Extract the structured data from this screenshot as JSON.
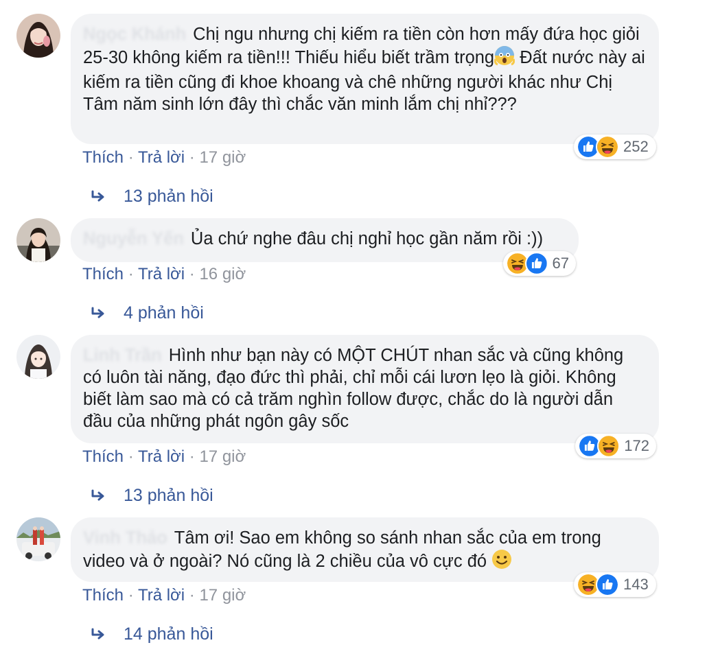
{
  "comments": [
    {
      "author": "Ngọc Khánh",
      "text_before_emoji": "Chị ngu nhưng chị kiếm ra tiền còn hơn mấy đứa học giỏi 25-30 không kiếm ra tiền!!! Thiếu hiểu biết trầm trọng",
      "emoji": "scream-emoji",
      "text_after_emoji": " Đất nước này ai kiếm ra tiền cũng đi khoe khoang và chê những người khác như Chị Tâm năm sinh lớn đây thì chắc văn minh lắm chị nhỉ???",
      "reactions": [
        "like",
        "haha"
      ],
      "reaction_count": "252",
      "like_label": "Thích",
      "reply_label": "Trả lời",
      "time": "17 giờ",
      "separator": " · ",
      "replies_label": "13 phản hồi"
    },
    {
      "author": "Nguyễn Yến",
      "text": "Ủa chứ nghe đâu chị nghỉ học gần năm rồi :))",
      "reactions": [
        "haha",
        "like"
      ],
      "reaction_count": "67",
      "like_label": "Thích",
      "reply_label": "Trả lời",
      "time": "16 giờ",
      "separator": " · ",
      "replies_label": "4 phản hồi"
    },
    {
      "author": "Linh Trần",
      "text": "Hình như bạn này có MỘT CHÚT nhan sắc và cũng không có luôn tài năng, đạo đức thì phải, chỉ mỗi cái lươn lẹo là giỏi. Không biết làm sao mà có cả trăm nghìn follow được, chắc do là người dẫn đầu của những phát ngôn gây sốc",
      "reactions": [
        "like",
        "haha"
      ],
      "reaction_count": "172",
      "like_label": "Thích",
      "reply_label": "Trả lời",
      "time": "17 giờ",
      "separator": " · ",
      "replies_label": "13 phản hồi"
    },
    {
      "author": "Vinh Thảo",
      "text": "Tâm ơi! Sao em không so sánh nhan sắc của em trong video và ở ngoài? Nó cũng là 2 chiều của vô cực đó",
      "emoji": "smile-emoji",
      "reactions": [
        "haha",
        "like"
      ],
      "reaction_count": "143",
      "like_label": "Thích",
      "reply_label": "Trả lời",
      "time": "17 giờ",
      "separator": " · ",
      "replies_label": "14 phản hồi"
    }
  ],
  "colors": {
    "bubble_bg": "#f2f3f5",
    "link": "#385898",
    "meta": "#90949c",
    "like_blue": "#1877f2",
    "haha_yellow": "#f7b125"
  }
}
